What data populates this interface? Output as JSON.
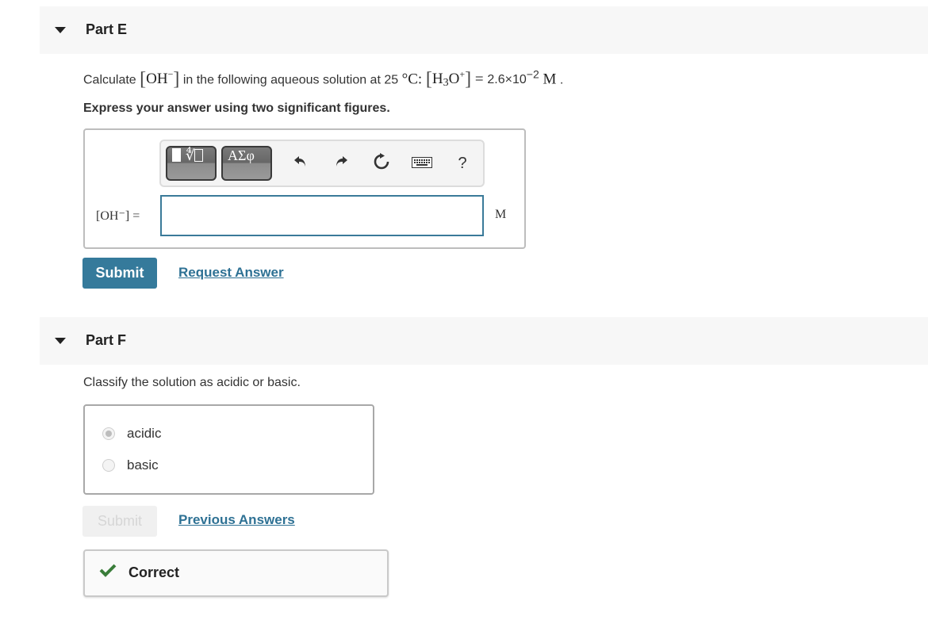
{
  "part_e": {
    "title": "Part E",
    "prompt": {
      "lead": "Calculate ",
      "species_oh": "OH",
      "charge_minus": "−",
      "middle": " in the following aqueous solution at 25 ",
      "temp_unit": "°C",
      "colon": ": ",
      "species_h3o_h": "H",
      "species_h3o_sub": "3",
      "species_h3o_o": "O",
      "charge_plus": "+",
      "equals": " = ",
      "value_mantissa": "2.6×10",
      "value_exponent": "−2",
      "unit": " M",
      "period": " ."
    },
    "instruction": "Express your answer using two significant figures.",
    "toolbar": {
      "template_button_icons": "templates-icon",
      "greek_button_label": "ΑΣφ",
      "undo_icon": "↶",
      "redo_icon": "↷",
      "reset_icon": "↻",
      "keyboard_icon": "⌨",
      "help_label": "?"
    },
    "answer_label": "[OH⁻] =",
    "answer_value": "",
    "answer_unit": "M",
    "submit_label": "Submit",
    "request_answer_label": "Request Answer"
  },
  "part_f": {
    "title": "Part F",
    "question": "Classify the solution as acidic or basic.",
    "choices": [
      {
        "label": "acidic",
        "selected": true
      },
      {
        "label": "basic",
        "selected": false
      }
    ],
    "submit_label": "Submit",
    "previous_answers_label": "Previous Answers",
    "feedback": "Correct",
    "feedback_color": "#3a7d3a"
  }
}
